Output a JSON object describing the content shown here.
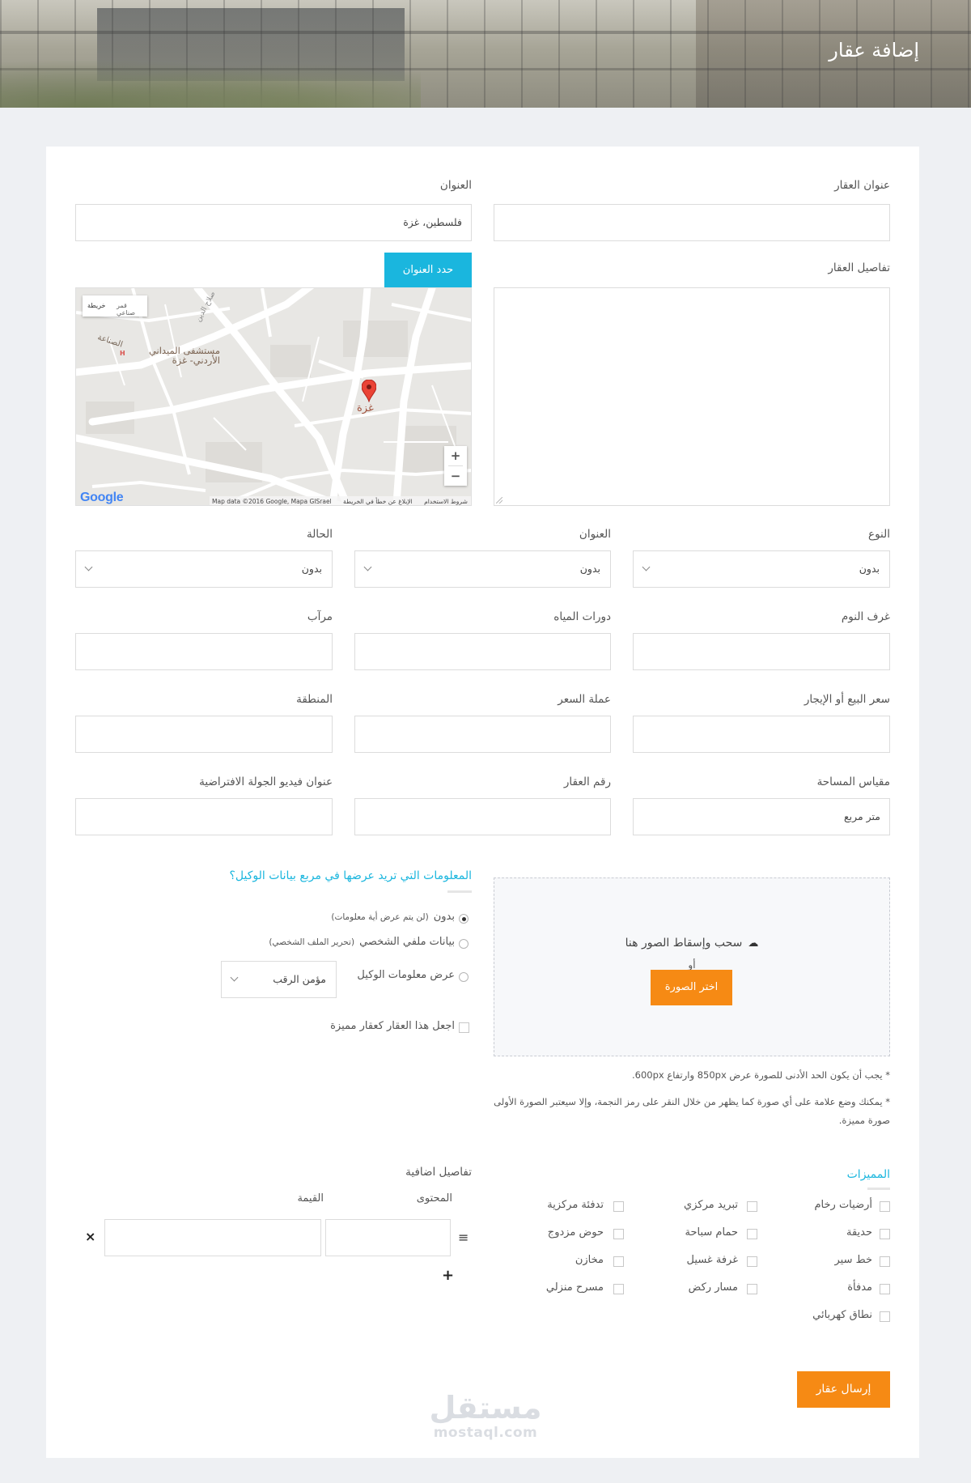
{
  "header": {
    "title": "إضافة عقار"
  },
  "form": {
    "property_title_label": "عنوان العقار",
    "address_label": "العنوان",
    "address_value": "فلسطين، غزة",
    "locate_button": "حدد العنوان",
    "details_label": "تفاصيل العقار",
    "map": {
      "type_map": "خريطة",
      "type_satellite": "قمر صناعي",
      "pin_label": "غزة",
      "hospital_label_line1": "مستشفى الميداني",
      "hospital_label_line2": "الأردني- غزة",
      "street_label": "الصناعة",
      "street_label_2": "صلاح الدين",
      "brand": "Google",
      "attribution": "Map data ©2016 Google, Mapa GISrael",
      "terms": "شروط الاستخدام",
      "report": "الإبلاغ عن خطأ في الخريطة",
      "zoom_in": "+",
      "zoom_out": "−"
    },
    "type_label": "النوع",
    "type_value": "بدون",
    "address2_label": "العنوان",
    "address2_value": "بدون",
    "status_label": "الحالة",
    "status_value": "بدون",
    "bedrooms_label": "غرف النوم",
    "bathrooms_label": "دورات المياه",
    "garage_label": "مرآب",
    "price_label": "سعر البيع أو الإيجار",
    "currency_label": "عملة السعر",
    "area_label": "المنطقة",
    "size_label": "مقياس المساحة",
    "size_value": "متر مربع",
    "property_id_label": "رقم العقار",
    "video_label": "عنوان فيديو الجولة الافتراضية"
  },
  "upload": {
    "title": "سحب وإسقاط الصور هنا",
    "cloud_icon": "☁",
    "or": "أو",
    "button": "اختر الصورة",
    "note1": "* يجب أن يكون الحد الأدنى للصورة عرض 850px وارتفاع 600px.",
    "note2": "* يمكنك وضع علامة على أي صورة كما يظهر من خلال النقر على رمز النجمة، وإلا سيعتبر الصورة الأولى صورة مميزة."
  },
  "agent": {
    "title": "المعلومات التي تريد عرضها في مربع بيانات الوكيل؟",
    "opt_none": "بدون",
    "opt_none_hint": "(لن يتم عرض أية معلومات)",
    "opt_profile": "بيانات ملفي الشخصي",
    "opt_profile_hint": "(تحرير الملف الشخصي)",
    "opt_agent": "عرض معلومات الوكيل",
    "agent_select": "مؤمن الرقب",
    "featured": "اجعل هذا العقار كعقار مميزة"
  },
  "features": {
    "title": "المميزات",
    "items": [
      "أرضيات رخام",
      "تبريد مركزي",
      "تدفئة مركزية",
      "حديقة",
      "حمام سباحة",
      "حوض مزدوج",
      "خط سير",
      "غرفة غسيل",
      "مخازن",
      "مدفأة",
      "مسار ركض",
      "مسرح منزلي",
      "نطاق كهربائي"
    ]
  },
  "extra": {
    "title": "تفاصيل اضافية",
    "col_content": "المحتوى",
    "col_value": "القيمة",
    "drag_icon": "≡",
    "remove_icon": "×",
    "add_icon": "+"
  },
  "submit": "إرسال عقار",
  "watermark": {
    "ar": "مستقل",
    "en": "mostaql.com"
  },
  "colors": {
    "accent_cyan": "#1ab6de",
    "accent_orange": "#f68a14",
    "page_bg": "#eef0f3"
  }
}
